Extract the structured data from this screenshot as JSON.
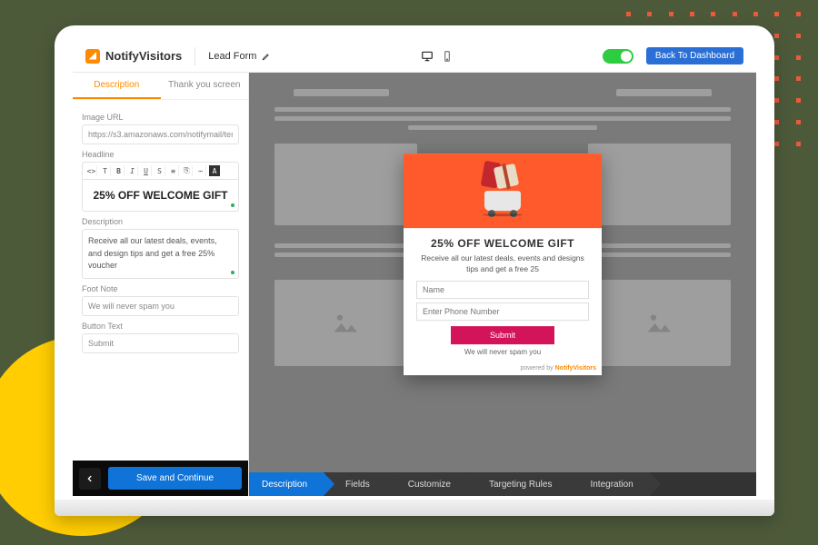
{
  "brand": {
    "name": "NotifyVisitors"
  },
  "header": {
    "title": "Lead Form",
    "back_to_dashboard": "Back To Dashboard"
  },
  "sidebar": {
    "tabs": {
      "description": "Description",
      "thankyou": "Thank you screen"
    },
    "image_url_label": "Image URL",
    "image_url_value": "https://s3.amazonaws.com/notifymail/templa",
    "headline_label": "Headline",
    "headline_value": "25% OFF WELCOME GIFT",
    "desc_label": "Description",
    "desc_value": "Receive all our latest deals, events, and design tips and get a free  25% voucher",
    "footnote_label": "Foot Note",
    "footnote_value": "We will never spam you",
    "button_text_label": "Button Text",
    "button_text_value": "Submit",
    "save_label": "Save and Continue"
  },
  "popup": {
    "headline": "25% OFF WELCOME GIFT",
    "desc": "Receive all our latest deals, events and designs tips and get a free 25",
    "name_ph": "Name",
    "phone_ph": "Enter Phone Number",
    "submit": "Submit",
    "footnote": "We will never spam you",
    "powered_prefix": "powered by ",
    "powered_brand": "NotifyVisitors"
  },
  "steps": [
    "Description",
    "Fields",
    "Customize",
    "Targeting Rules",
    "Integration"
  ],
  "toolbar_icons": [
    "code",
    "text",
    "bold",
    "italic",
    "underline",
    "strike",
    "list",
    "link",
    "more",
    "color",
    "ai"
  ]
}
